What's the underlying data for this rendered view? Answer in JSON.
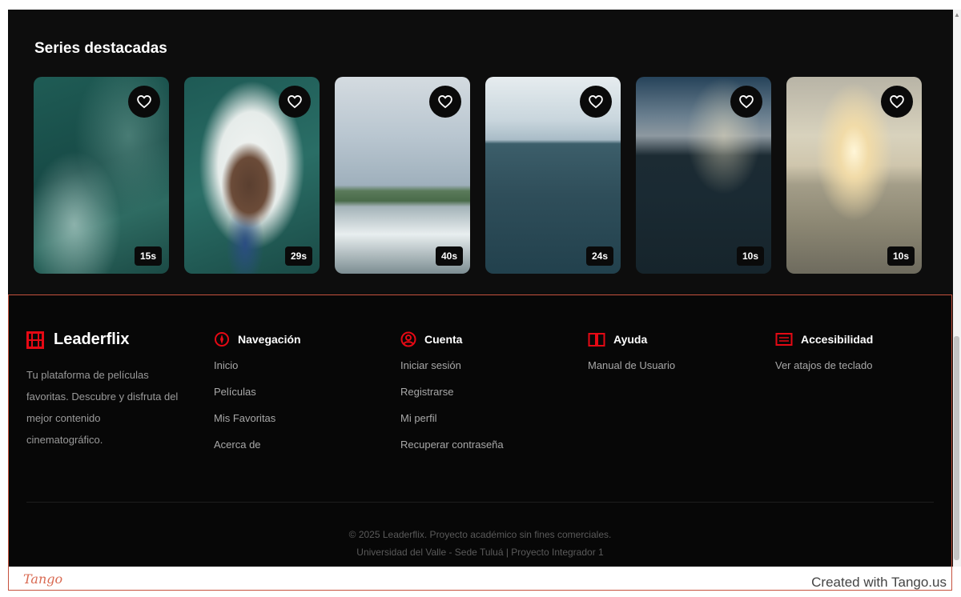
{
  "featured": {
    "title": "Series destacadas",
    "cards": [
      {
        "duration": "15s"
      },
      {
        "duration": "29s"
      },
      {
        "duration": "40s"
      },
      {
        "duration": "24s"
      },
      {
        "duration": "10s"
      },
      {
        "duration": "10s"
      }
    ]
  },
  "footer": {
    "brand": {
      "name": "Leaderflix",
      "description": "Tu plataforma de películas favoritas. Descubre y disfruta del mejor contenido cinematográfico."
    },
    "columns": [
      {
        "title": "Navegación",
        "icon": "compass-icon",
        "links": [
          "Inicio",
          "Películas",
          "Mis Favoritas",
          "Acerca de"
        ]
      },
      {
        "title": "Cuenta",
        "icon": "user-icon",
        "links": [
          "Iniciar sesión",
          "Registrarse",
          "Mi perfil",
          "Recuperar contraseña"
        ]
      },
      {
        "title": "Ayuda",
        "icon": "book-icon",
        "links": [
          "Manual de Usuario"
        ]
      },
      {
        "title": "Accesibilidad",
        "icon": "keyboard-icon",
        "links": [
          "Ver atajos de teclado"
        ]
      }
    ],
    "copyright_line1": "© 2025 Leaderflix. Proyecto académico sin fines comerciales.",
    "copyright_line2": "Universidad del Valle - Sede Tuluá | Proyecto Integrador 1"
  },
  "tango": {
    "logo": "Tango",
    "credit": "Created with Tango.us"
  },
  "colors": {
    "accent": "#e50914",
    "background": "#0d0d0d",
    "highlight_border": "#c6523d"
  }
}
